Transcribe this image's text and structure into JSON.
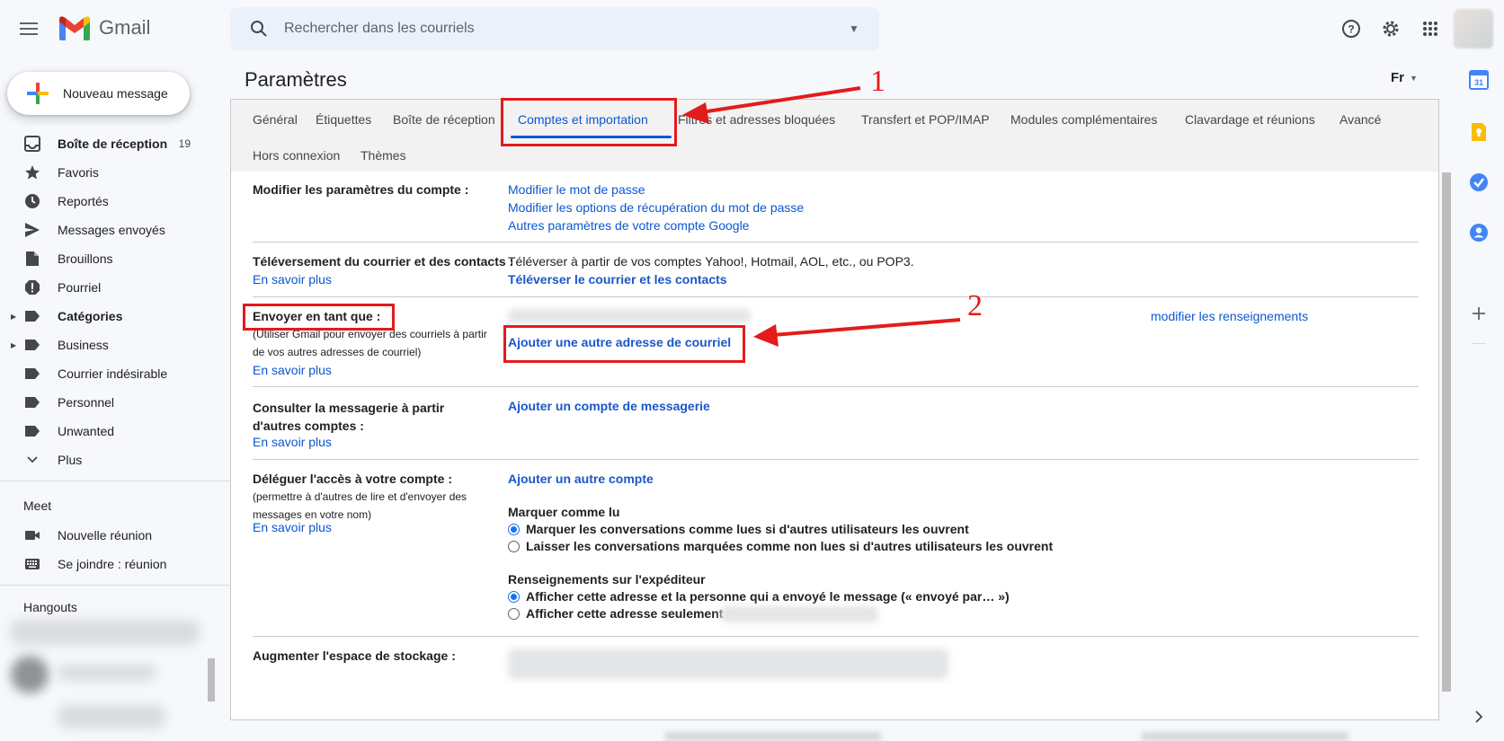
{
  "header": {
    "app_name": "Gmail",
    "search_placeholder": "Rechercher dans les courriels",
    "icons": [
      "menu-icon",
      "search-icon",
      "dropdown-caret-icon",
      "help-icon",
      "settings-gear-icon",
      "apps-grid-icon",
      "account-avatar"
    ]
  },
  "compose": {
    "label": "Nouveau message"
  },
  "nav": {
    "items": [
      {
        "label": "Boîte de réception",
        "count": "19",
        "icon": "inbox-icon",
        "bold": true
      },
      {
        "label": "Favoris",
        "icon": "star-icon"
      },
      {
        "label": "Reportés",
        "icon": "clock-icon"
      },
      {
        "label": "Messages envoyés",
        "icon": "send-icon"
      },
      {
        "label": "Brouillons",
        "icon": "draft-icon"
      },
      {
        "label": "Pourriel",
        "icon": "spam-icon"
      },
      {
        "label": "Catégories",
        "icon": "label-icon",
        "bold": true,
        "expandable": true
      },
      {
        "label": "Business",
        "icon": "label-icon",
        "expandable": true
      },
      {
        "label": "Courrier indésirable",
        "icon": "label-icon"
      },
      {
        "label": "Personnel",
        "icon": "label-icon"
      },
      {
        "label": "Unwanted",
        "icon": "label-icon"
      },
      {
        "label": "Plus",
        "icon": "chevron-down-icon"
      }
    ],
    "meet": {
      "title": "Meet",
      "items": [
        {
          "label": "Nouvelle réunion",
          "icon": "video-icon"
        },
        {
          "label": "Se joindre : réunion",
          "icon": "keyboard-icon"
        }
      ]
    },
    "hangouts": {
      "title": "Hangouts"
    }
  },
  "settings": {
    "title": "Paramètres",
    "language": "Fr",
    "tabs_row1": [
      "Général",
      "Étiquettes",
      "Boîte de réception",
      "Comptes et importation",
      "Filtres et adresses bloquées",
      "Transfert et POP/IMAP",
      "Modules complémentaires",
      "Clavardage et réunions",
      "Avancé"
    ],
    "tabs_row2": [
      "Hors connexion",
      "Thèmes"
    ],
    "active_tab": "Comptes et importation",
    "sections": {
      "account": {
        "label": "Modifier les paramètres du compte :",
        "links": [
          "Modifier le mot de passe",
          "Modifier les options de récupération du mot de passe",
          "Autres paramètres de votre compte Google"
        ]
      },
      "import": {
        "label": "Téléversement du courrier et des contacts :",
        "learn_more": "En savoir plus",
        "text": "Téléverser à partir de vos comptes Yahoo!, Hotmail, AOL, etc., ou POP3.",
        "action": "Téléverser le courrier et les contacts"
      },
      "send_as": {
        "label": "Envoyer en tant que :",
        "sub": "(Utiliser Gmail pour envoyer des courriels à partir de vos autres adresses de courriel)",
        "learn_more": "En savoir plus",
        "edit": "modifier les renseignements",
        "action": "Ajouter une autre adresse de courriel"
      },
      "check_mail": {
        "label": "Consulter la messagerie à partir d'autres comptes :",
        "learn_more": "En savoir plus",
        "action": "Ajouter un compte de messagerie"
      },
      "delegate": {
        "label": "Déléguer l'accès à votre compte :",
        "sub": "(permettre à d'autres de lire et d'envoyer des messages en votre nom)",
        "learn_more": "En savoir plus",
        "action": "Ajouter un autre compte",
        "mark_read_title": "Marquer comme lu",
        "mark_read_options": [
          {
            "label": "Marquer les conversations comme lues si d'autres utilisateurs les ouvrent",
            "checked": true
          },
          {
            "label": "Laisser les conversations marquées comme non lues si d'autres utilisateurs les ouvrent",
            "checked": false
          }
        ],
        "sender_info_title": "Renseignements sur l'expéditeur",
        "sender_info_options": [
          {
            "label": "Afficher cette adresse et la personne qui a envoyé le message (« envoyé par… »)",
            "checked": true
          },
          {
            "label": "Afficher cette adresse seulement",
            "checked": false
          }
        ]
      },
      "storage": {
        "label": "Augmenter l'espace de stockage :"
      }
    }
  },
  "annotations": {
    "marker_1": "1",
    "marker_2": "2",
    "color": "#e31b1b"
  },
  "side_panel": {
    "icons": [
      "calendar-icon",
      "keep-icon",
      "tasks-icon",
      "contacts-icon",
      "add-icon",
      "expand-chevron-icon"
    ],
    "calendar_day": "31"
  }
}
